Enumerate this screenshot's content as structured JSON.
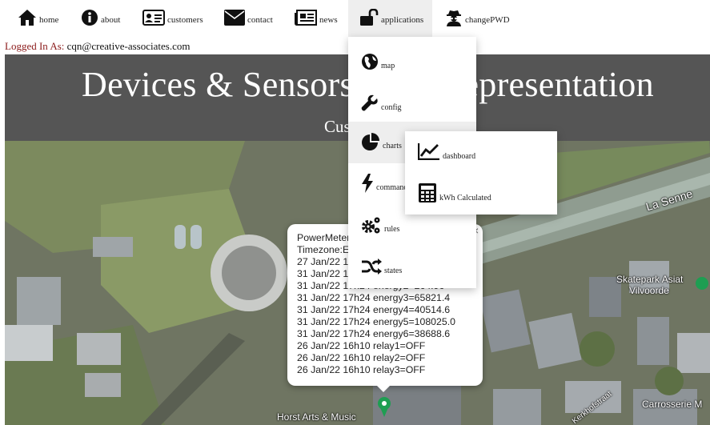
{
  "nav": {
    "items": [
      {
        "label": "home",
        "icon": "home-icon"
      },
      {
        "label": "about",
        "icon": "info-icon"
      },
      {
        "label": "customers",
        "icon": "address-card-icon"
      },
      {
        "label": "contact",
        "icon": "envelope-icon"
      },
      {
        "label": "news",
        "icon": "newspaper-icon"
      },
      {
        "label": "applications",
        "icon": "unlock-icon"
      },
      {
        "label": "changePWD",
        "icon": "user-secret-icon"
      }
    ]
  },
  "login": {
    "prefix": "Logged In As:",
    "email": "cqn@creative-associates.com"
  },
  "banner": {
    "title": "Devices & Sensors Data Representation",
    "subtitle": "Cus"
  },
  "dropdown": {
    "items": [
      {
        "label": "map",
        "icon": "globe-icon"
      },
      {
        "label": "config",
        "icon": "wrench-icon"
      },
      {
        "label": "charts",
        "icon": "pie-chart-icon"
      },
      {
        "label": "command",
        "icon": "bolt-icon"
      },
      {
        "label": "rules",
        "icon": "cogs-icon"
      },
      {
        "label": "states",
        "icon": "random-icon"
      }
    ],
    "submenu": [
      {
        "label": "dashboard",
        "icon": "line-chart-icon"
      },
      {
        "label": "kWh Calculated",
        "icon": "calculator-icon"
      }
    ]
  },
  "popup": {
    "lines": [
      "PowerMeter",
      "Timezone:E",
      "27 Jan/22 1",
      "31 Jan/22 1",
      "31 Jan/22 17h24 energy2=264.96",
      "31 Jan/22 17h24 energy3=65821.4",
      "31 Jan/22 17h24 energy4=40514.6",
      "31 Jan/22 17h24 energy5=108025.0",
      "31 Jan/22 17h24 energy6=38688.6",
      "26 Jan/22 16h10 relay1=OFF",
      "26 Jan/22 16h10 relay2=OFF",
      "26 Jan/22 16h10 relay3=OFF"
    ],
    "close": "×"
  },
  "map_labels": {
    "la_senne": "La Senne",
    "skatepark_1": "Skatepark Asiat",
    "skatepark_2": "Vilvoorde",
    "horst": "Horst Arts & Music",
    "kerkhof": "Kerkhofstraat",
    "carrosserie": "Carrosserie M"
  }
}
